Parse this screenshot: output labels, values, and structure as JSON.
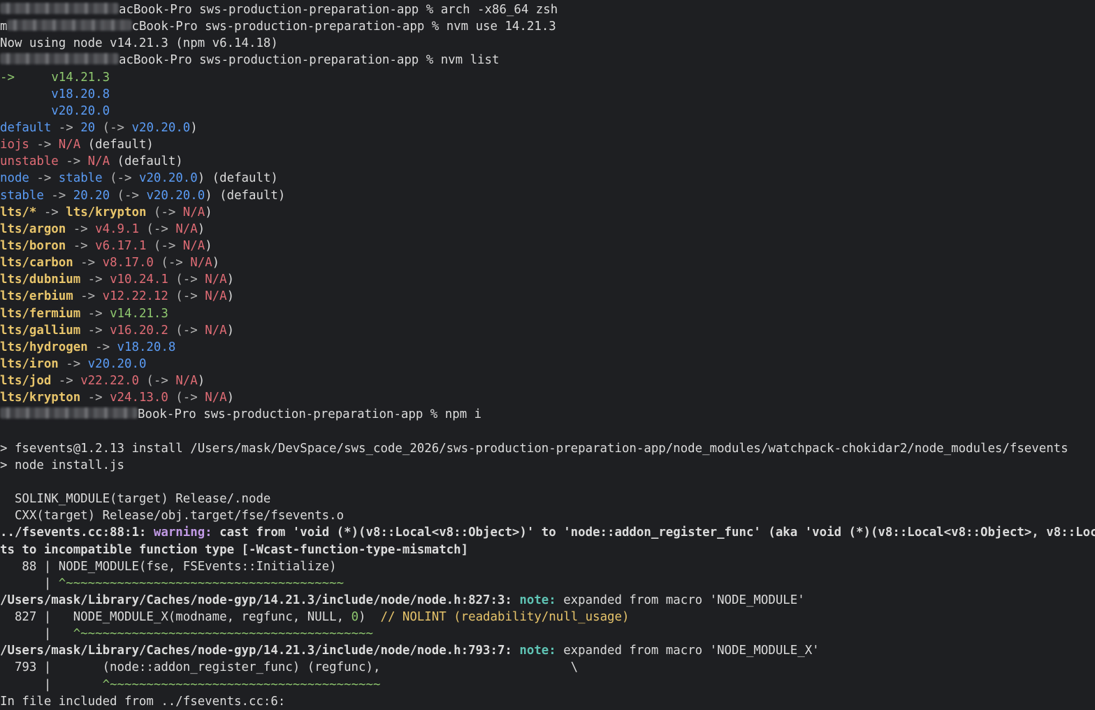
{
  "terminal": {
    "prompt": {
      "host_suffix_1": "acBook-Pro sws-production-preparation-app % ",
      "host_suffix_2": "cBook-Pro sws-production-preparation-app % ",
      "host_suffix_3": "acBook-Pro sws-production-preparation-app % ",
      "host_suffix_4": "Book-Pro sws-production-preparation-app % ",
      "user_initial": "m"
    },
    "commands": {
      "arch": "arch -x86_64 zsh",
      "nvm_use": "nvm use 14.21.3",
      "nvm_list": "nvm list",
      "npm_i": "npm i"
    },
    "nvm_use_output": "Now using node v14.21.3 (npm v6.14.18)",
    "nvm_list": {
      "current_marker": "->",
      "installed": [
        "v14.21.3",
        "v18.20.8",
        "v20.20.0"
      ],
      "aliases": {
        "default": {
          "name": "default",
          "arrow": " -> ",
          "target": "20",
          "open": " (-> ",
          "resolved": "v20.20.0",
          "close": ")"
        },
        "iojs": {
          "name": "iojs",
          "arrow": " -> ",
          "target": "N/A",
          "suffix": " (default)"
        },
        "unstable": {
          "name": "unstable",
          "arrow": " -> ",
          "target": "N/A",
          "suffix": " (default)"
        },
        "node": {
          "name": "node",
          "arrow": " -> ",
          "target": "stable",
          "open": " (-> ",
          "resolved": "v20.20.0",
          "close": ") (default)"
        },
        "stable": {
          "name": "stable",
          "arrow": " -> ",
          "target": "20.20",
          "open": " (-> ",
          "resolved": "v20.20.0",
          "close": ") (default)"
        }
      },
      "lts": [
        {
          "name": "lts/*",
          "target": "lts/krypton",
          "resolved": "N/A",
          "target_color": "yellow",
          "resolved_color": "red"
        },
        {
          "name": "lts/argon",
          "target": "v4.9.1",
          "resolved": "N/A",
          "target_color": "red",
          "resolved_color": "red"
        },
        {
          "name": "lts/boron",
          "target": "v6.17.1",
          "resolved": "N/A",
          "target_color": "red",
          "resolved_color": "red"
        },
        {
          "name": "lts/carbon",
          "target": "v8.17.0",
          "resolved": "N/A",
          "target_color": "red",
          "resolved_color": "red"
        },
        {
          "name": "lts/dubnium",
          "target": "v10.24.1",
          "resolved": "N/A",
          "target_color": "red",
          "resolved_color": "red"
        },
        {
          "name": "lts/erbium",
          "target": "v12.22.12",
          "resolved": "N/A",
          "target_color": "red",
          "resolved_color": "red"
        },
        {
          "name": "lts/fermium",
          "target": "v14.21.3",
          "resolved": "",
          "target_color": "green",
          "resolved_color": ""
        },
        {
          "name": "lts/gallium",
          "target": "v16.20.2",
          "resolved": "N/A",
          "target_color": "red",
          "resolved_color": "red"
        },
        {
          "name": "lts/hydrogen",
          "target": "v18.20.8",
          "resolved": "",
          "target_color": "blue",
          "resolved_color": ""
        },
        {
          "name": "lts/iron",
          "target": "v20.20.0",
          "resolved": "",
          "target_color": "blue",
          "resolved_color": ""
        },
        {
          "name": "lts/jod",
          "target": "v22.22.0",
          "resolved": "N/A",
          "target_color": "red",
          "resolved_color": "red"
        },
        {
          "name": "lts/krypton",
          "target": "v24.13.0",
          "resolved": "N/A",
          "target_color": "red",
          "resolved_color": "red"
        }
      ]
    },
    "npm_output": {
      "fsevents_install": "> fsevents@1.2.13 install /Users/mask/DevSpace/sws_code_2026/sws-production-preparation-app/node_modules/watchpack-chokidar2/node_modules/fsevents",
      "node_install": "> node install.js",
      "solink": "  SOLINK_MODULE(target) Release/.node",
      "cxx": "  CXX(target) Release/obj.target/fse/fsevents.o",
      "warning_loc": "../fsevents.cc:88:1: ",
      "warning_label": "warning:",
      "warning_msg": " cast from 'void (*)(v8::Local<v8::Object>)' to 'node::addon_register_func' (aka 'void (*)(v8::Local<v8::Object>, v8::Loc",
      "warning_cont": "ts to incompatible function type [-Wcast-function-type-mismatch]",
      "src_88": "   88 | NODE_MODULE(fse, FSEvents::Initialize)",
      "caret_88_prefix": "      | ",
      "caret_88": "^~~~~~~~~~~~~~~~~~~~~~~~~~~~~~~~~~~~~~~",
      "note1_loc": "/Users/mask/Library/Caches/node-gyp/14.21.3/include/node/node.h:827:3: ",
      "note_label": "note:",
      "note1_msg": " expanded from macro 'NODE_MODULE'",
      "src_827_prefix": "  827 |   NODE_MODULE_X(modname, regfunc, NULL, ",
      "src_827_zero": "0",
      "src_827_close": ")  ",
      "src_827_comment": "// NOLINT (readability/null_usage)",
      "caret_827_prefix": "      |   ",
      "caret_827": "^~~~~~~~~~~~~~~~~~~~~~~~~~~~~~~~~~~~~~~~~",
      "note2_loc": "/Users/mask/Library/Caches/node-gyp/14.21.3/include/node/node.h:793:7: ",
      "note2_msg": " expanded from macro 'NODE_MODULE_X'",
      "src_793": "  793 |       (node::addon_register_func) (regfunc),                          \\",
      "caret_793_prefix": "      |       ",
      "caret_793": "^~~~~~~~~~~~~~~~~~~~~~~~~~~~~~~~~~~~~~",
      "included_from": "In file included from ../fsevents.cc:6:"
    }
  }
}
